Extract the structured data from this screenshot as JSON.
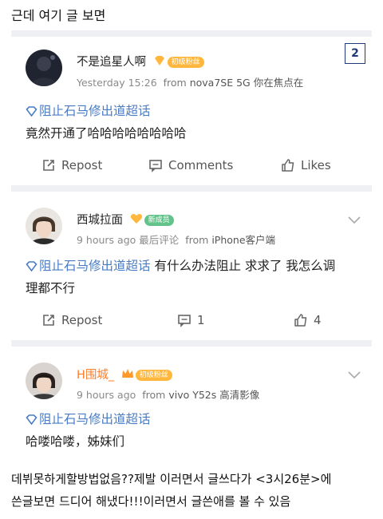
{
  "caption_top": "근데 여기 글 보면",
  "posts": [
    {
      "username": "不是追星人啊",
      "level_badge": "初级粉丝",
      "time": "Yesterday 15:26",
      "from_label": "from",
      "device": "nova7SE 5G 你在焦点在",
      "topic": "阻止石马修出道超话",
      "text": "竟然开通了哈哈哈哈哈哈哈哈",
      "repost": "Repost",
      "comments": "Comments",
      "likes": "Likes",
      "corner_number": "2"
    },
    {
      "username": "西城拉面",
      "level_badge": "新成员",
      "time": "9 hours ago",
      "extra": "最后评论",
      "from_label": "from",
      "device": "iPhone客户端",
      "topic": "阻止石马修出道超话",
      "text_line1": "有什么办法阻止 求求了 我怎么调",
      "text_line2": "理都不行",
      "repost": "Repost",
      "comments_count": "1",
      "likes_count": "4"
    },
    {
      "username": "H围城_",
      "level_badge": "初级粉丝",
      "time": "9 hours ago",
      "from_label": "from",
      "device": "vivo Y52s 高清影像",
      "topic": "阻止石马修出道超话",
      "text": "哈喽哈喽，姊妹们"
    }
  ],
  "caption_bottom_line1": "데뷔못하게할방법없음??제발 이러면서 글쓰다가 <3시26분>에",
  "caption_bottom_line2": "쓴글보면 드디어 해냈다!!!이러면서 글쓴애를 볼 수 있음"
}
